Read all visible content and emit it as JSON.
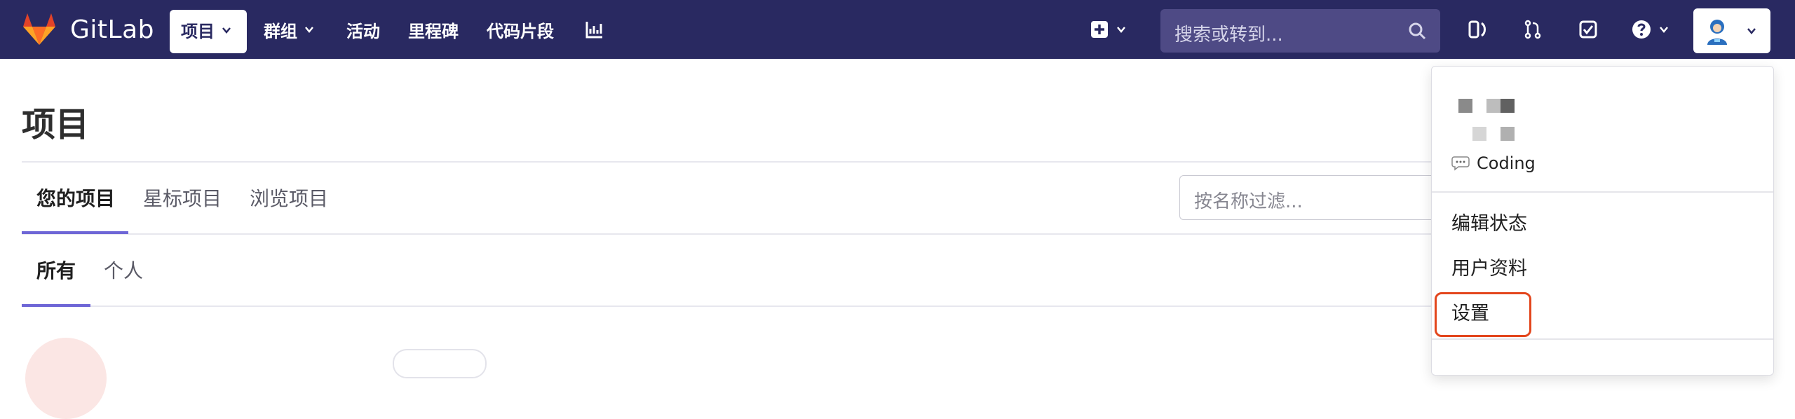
{
  "navbar": {
    "brand": "GitLab",
    "items": [
      {
        "label": "项目",
        "active": true,
        "has_chevron": true
      },
      {
        "label": "群组",
        "active": false,
        "has_chevron": true
      },
      {
        "label": "活动",
        "active": false,
        "has_chevron": false
      },
      {
        "label": "里程碑",
        "active": false,
        "has_chevron": false
      },
      {
        "label": "代码片段",
        "active": false,
        "has_chevron": false
      }
    ],
    "search_placeholder": "搜索或转到...",
    "icons": [
      "chart-icon",
      "plus-square-icon",
      "issues-icon",
      "merge-request-icon",
      "todo-check-icon",
      "help-icon",
      "user-avatar"
    ]
  },
  "page": {
    "title": "项目",
    "tabs": [
      "您的项目",
      "星标项目",
      "浏览项目"
    ],
    "subtabs": [
      "所有",
      "个人"
    ],
    "filter_placeholder": "按名称过滤..."
  },
  "dropdown": {
    "status_text": "Coding",
    "items": [
      "编辑状态",
      "用户资料",
      "设置"
    ],
    "highlighted": "设置"
  },
  "colors": {
    "navbar": "#292961",
    "accent_underline": "#6e66d6",
    "highlight_box": "#e3461d"
  }
}
